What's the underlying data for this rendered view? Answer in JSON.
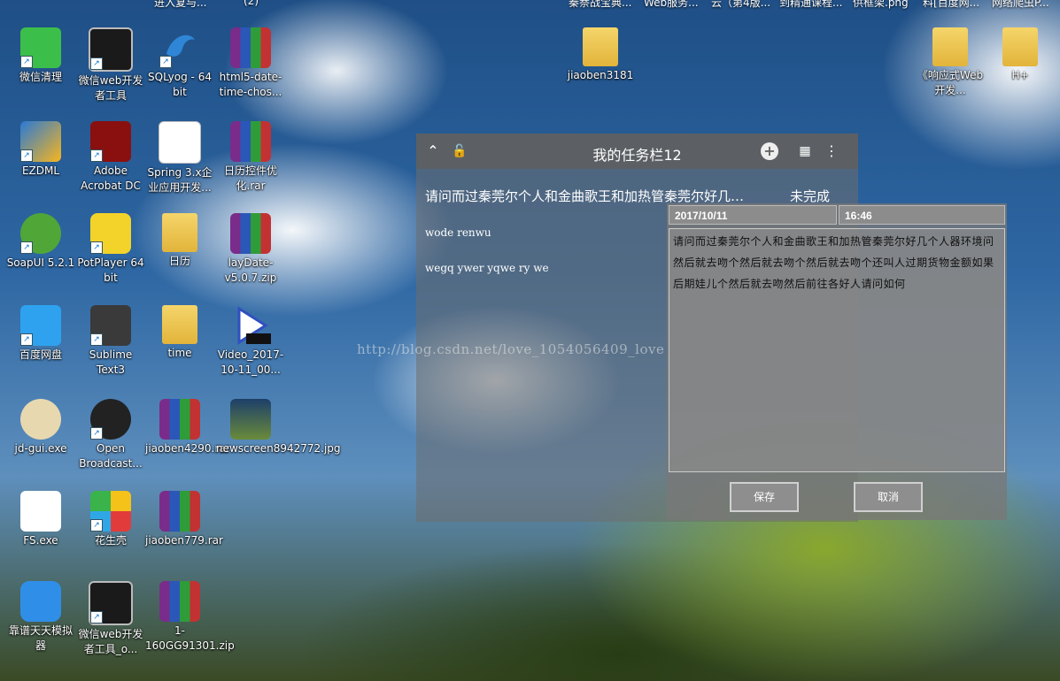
{
  "top_row_labels": [
    "进入复与...",
    "(2)",
    "秦萘战宝典...",
    "Web服务...",
    "云（第4版...",
    "到精通课程...",
    "供框架.png",
    "料[百度网...",
    "网络爬虫P..."
  ],
  "desktop_icons": [
    {
      "label": "微信清理",
      "icon": "wechat-icon"
    },
    {
      "label": "微信web开发者工具",
      "icon": "terminal-icon"
    },
    {
      "label": "SQLyog - 64 bit",
      "icon": "dolphin-icon"
    },
    {
      "label": "html5-date-time-chos...",
      "icon": "rar-archive-icon"
    },
    {
      "label": "EZDML",
      "icon": "ezdml-icon"
    },
    {
      "label": "Adobe Acrobat DC",
      "icon": "acrobat-icon"
    },
    {
      "label": "Spring 3.x企业应用开发...",
      "icon": "pdf-icon"
    },
    {
      "label": "日历控件优化.rar",
      "icon": "rar-archive-icon"
    },
    {
      "label": "SoapUI 5.2.1",
      "icon": "soapui-icon"
    },
    {
      "label": "PotPlayer 64 bit",
      "icon": "potplayer-icon"
    },
    {
      "label": "日历",
      "icon": "folder-icon"
    },
    {
      "label": "layDate-v5.0.7.zip",
      "icon": "rar-archive-icon"
    },
    {
      "label": "百度网盘",
      "icon": "baidu-cloud-icon"
    },
    {
      "label": "Sublime Text3",
      "icon": "sublime-icon"
    },
    {
      "label": "time",
      "icon": "folder-icon"
    },
    {
      "label": "Video_2017-10-11_00...",
      "icon": "wmv-video-icon"
    },
    {
      "label": "jd-gui.exe",
      "icon": "jdgui-icon"
    },
    {
      "label": "Open Broadcast...",
      "icon": "obs-icon"
    },
    {
      "label": "jiaoben4290.rar",
      "icon": "rar-archive-icon"
    },
    {
      "label": "newscreen8942772.jpg",
      "icon": "image-file-icon"
    },
    {
      "label": "FS.exe",
      "icon": "fs-icon"
    },
    {
      "label": "花生壳",
      "icon": "huasheng-icon"
    },
    {
      "label": "jiaoben779.rar",
      "icon": "rar-archive-icon"
    },
    {
      "label": "靠谱天天模拟器",
      "icon": "emulator-icon"
    },
    {
      "label": "微信web开发者工具_o...",
      "icon": "terminal-icon"
    },
    {
      "label": "1-160GG91301.zip",
      "icon": "rar-archive-icon"
    },
    {
      "label": "jiaoben3181",
      "icon": "folder-icon"
    },
    {
      "label": "《响应式Web开发...",
      "icon": "folder-icon"
    },
    {
      "label": "H+",
      "icon": "folder-icon"
    }
  ],
  "widget": {
    "title": "我的任务栏12",
    "main_task": "请问而过秦莞尔个人和金曲歌王和加热管秦莞尔好几…",
    "main_status": "未完成",
    "tasks": [
      "wode renwu",
      "wegq ywer yqwe ry we"
    ]
  },
  "editor": {
    "date": "2017/10/11",
    "time": "16:46",
    "content": "请问而过秦莞尔个人和金曲歌王和加热管秦莞尔好几个人器环境问然后就去吻个然后就去吻个然后就去吻个还叫人过期货物金额如果后期娃儿个然后就去吻然后前往各好人请问如何",
    "save_label": "保存",
    "cancel_label": "取消"
  },
  "watermark": "http://blog.csdn.net/love_1054056409_love"
}
